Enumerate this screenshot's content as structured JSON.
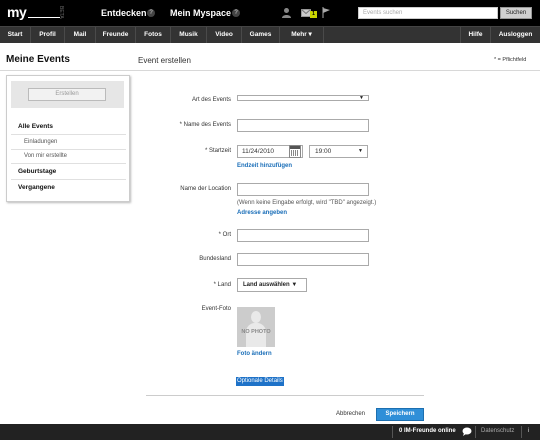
{
  "topbar": {
    "logo": "my",
    "logo_beta": "BETA",
    "links": [
      "Entdecken",
      "Mein Myspace"
    ],
    "help_glyph": "?",
    "mail_count": "1",
    "icons": [
      "user-icon",
      "mail-icon",
      "flag-icon"
    ],
    "search_placeholder": "Events suchen",
    "search_button": "Suchen"
  },
  "nav": {
    "items": [
      "Start",
      "Profil",
      "Mail",
      "Freunde",
      "Fotos",
      "Musik",
      "Video",
      "Games",
      "Mehr ▾"
    ],
    "right": [
      "Hilfe",
      "Ausloggen"
    ]
  },
  "sidebar": {
    "title": "Meine Events",
    "create_button": "Erstellen",
    "items": [
      {
        "label": "Alle Events"
      },
      {
        "label": "Einladungen"
      },
      {
        "label": "Von mir erstellte"
      },
      {
        "label": "Geburtstage"
      },
      {
        "label": "Vergangene"
      }
    ]
  },
  "form": {
    "title": "Event erstellen",
    "required_note": "* = Pflichtfeld",
    "event_type_label": "Art des Events",
    "event_name_label": "* Name des Events",
    "start_label": "* Startzeit",
    "start_date": "11/24/2010",
    "start_time": "19:00",
    "add_end_time": "Endzeit hinzufügen",
    "location_label": "Name der Location",
    "location_hint": "(Wenn keine Eingabe erfolgt, wird \"TBD\" angezeigt.)",
    "add_address": "Adresse angeben",
    "city_label": "* Ort",
    "state_label": "Bundesland",
    "country_label": "* Land",
    "country_select": "Land auswählen ▼",
    "photo_label": "Event-Foto",
    "no_photo": "NO PHOTO",
    "change_photo": "Foto ändern",
    "optional_details": "Optionale Details",
    "cancel": "Abbrechen",
    "save": "Speichern"
  },
  "footer": {
    "im": "0 IM-Freunde online",
    "privacy": "Datenschutz",
    "info_glyph": "i"
  }
}
